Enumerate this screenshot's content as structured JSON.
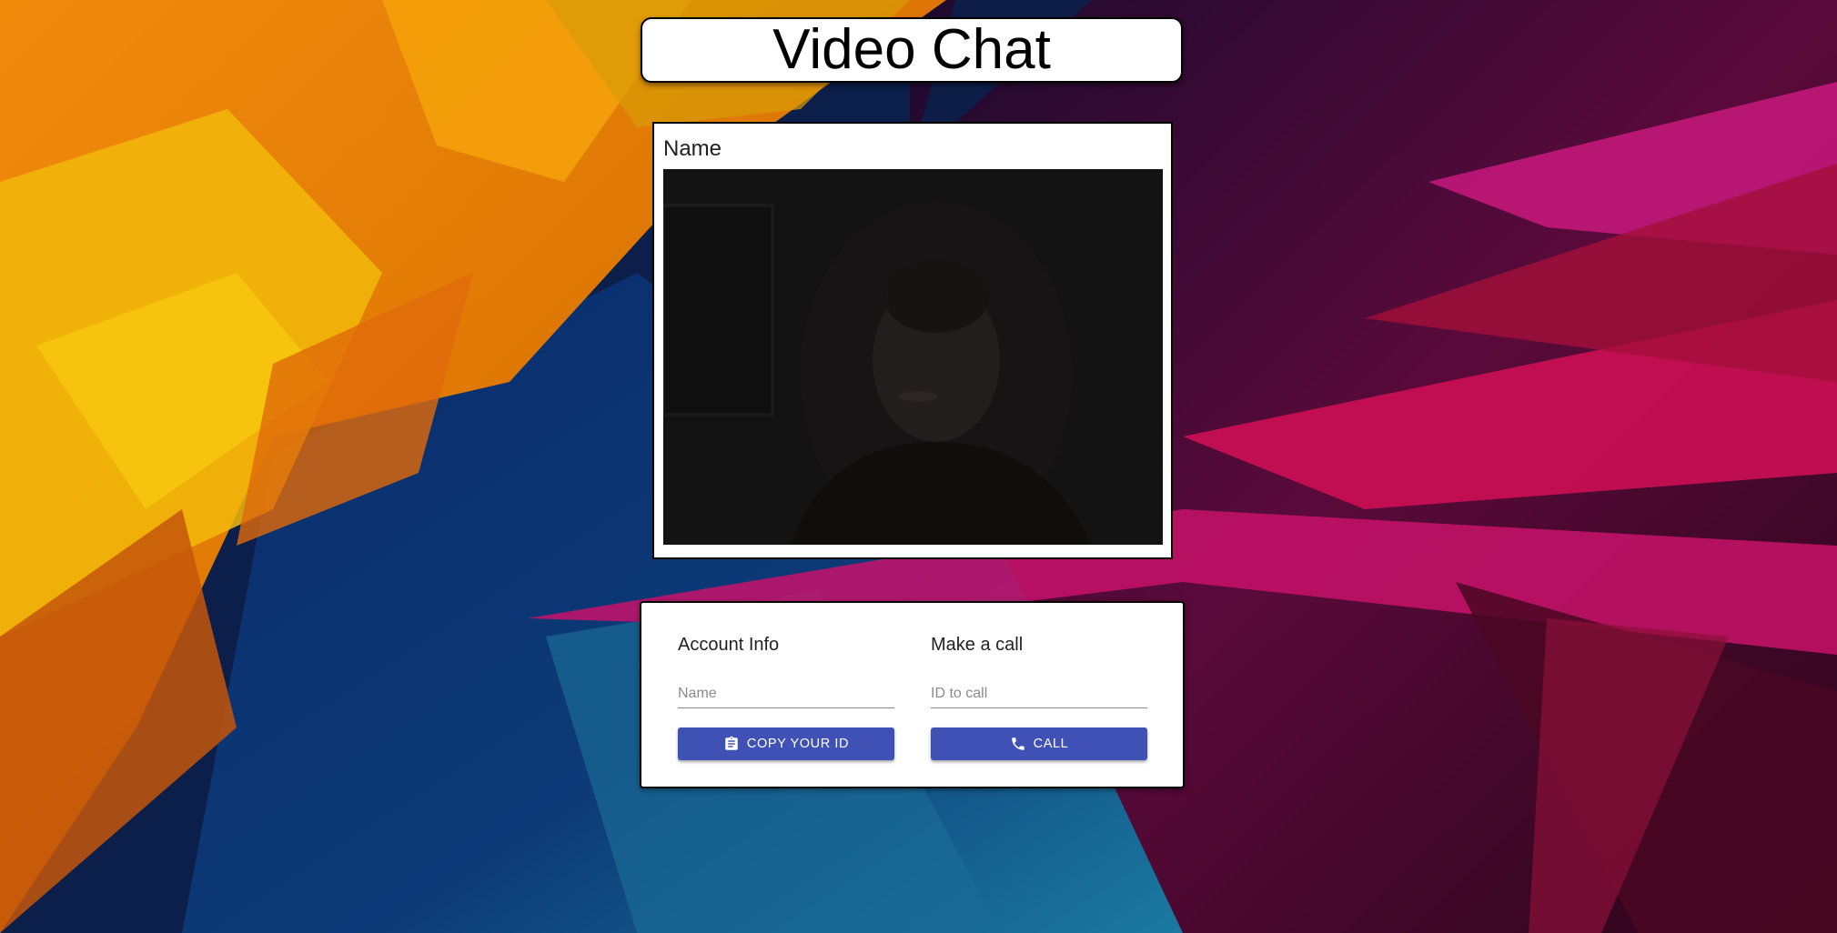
{
  "header": {
    "title": "Video Chat"
  },
  "video": {
    "name_label": "Name"
  },
  "account": {
    "heading": "Account Info",
    "name_placeholder": "Name",
    "copy_button_label": "COPY YOUR ID",
    "copy_button_icon": "clipboard-icon"
  },
  "call": {
    "heading": "Make a call",
    "id_placeholder": "ID to call",
    "call_button_label": "CALL",
    "call_button_icon": "phone-icon"
  },
  "colors": {
    "button": "#3f51b5",
    "card": "#ffffff"
  }
}
